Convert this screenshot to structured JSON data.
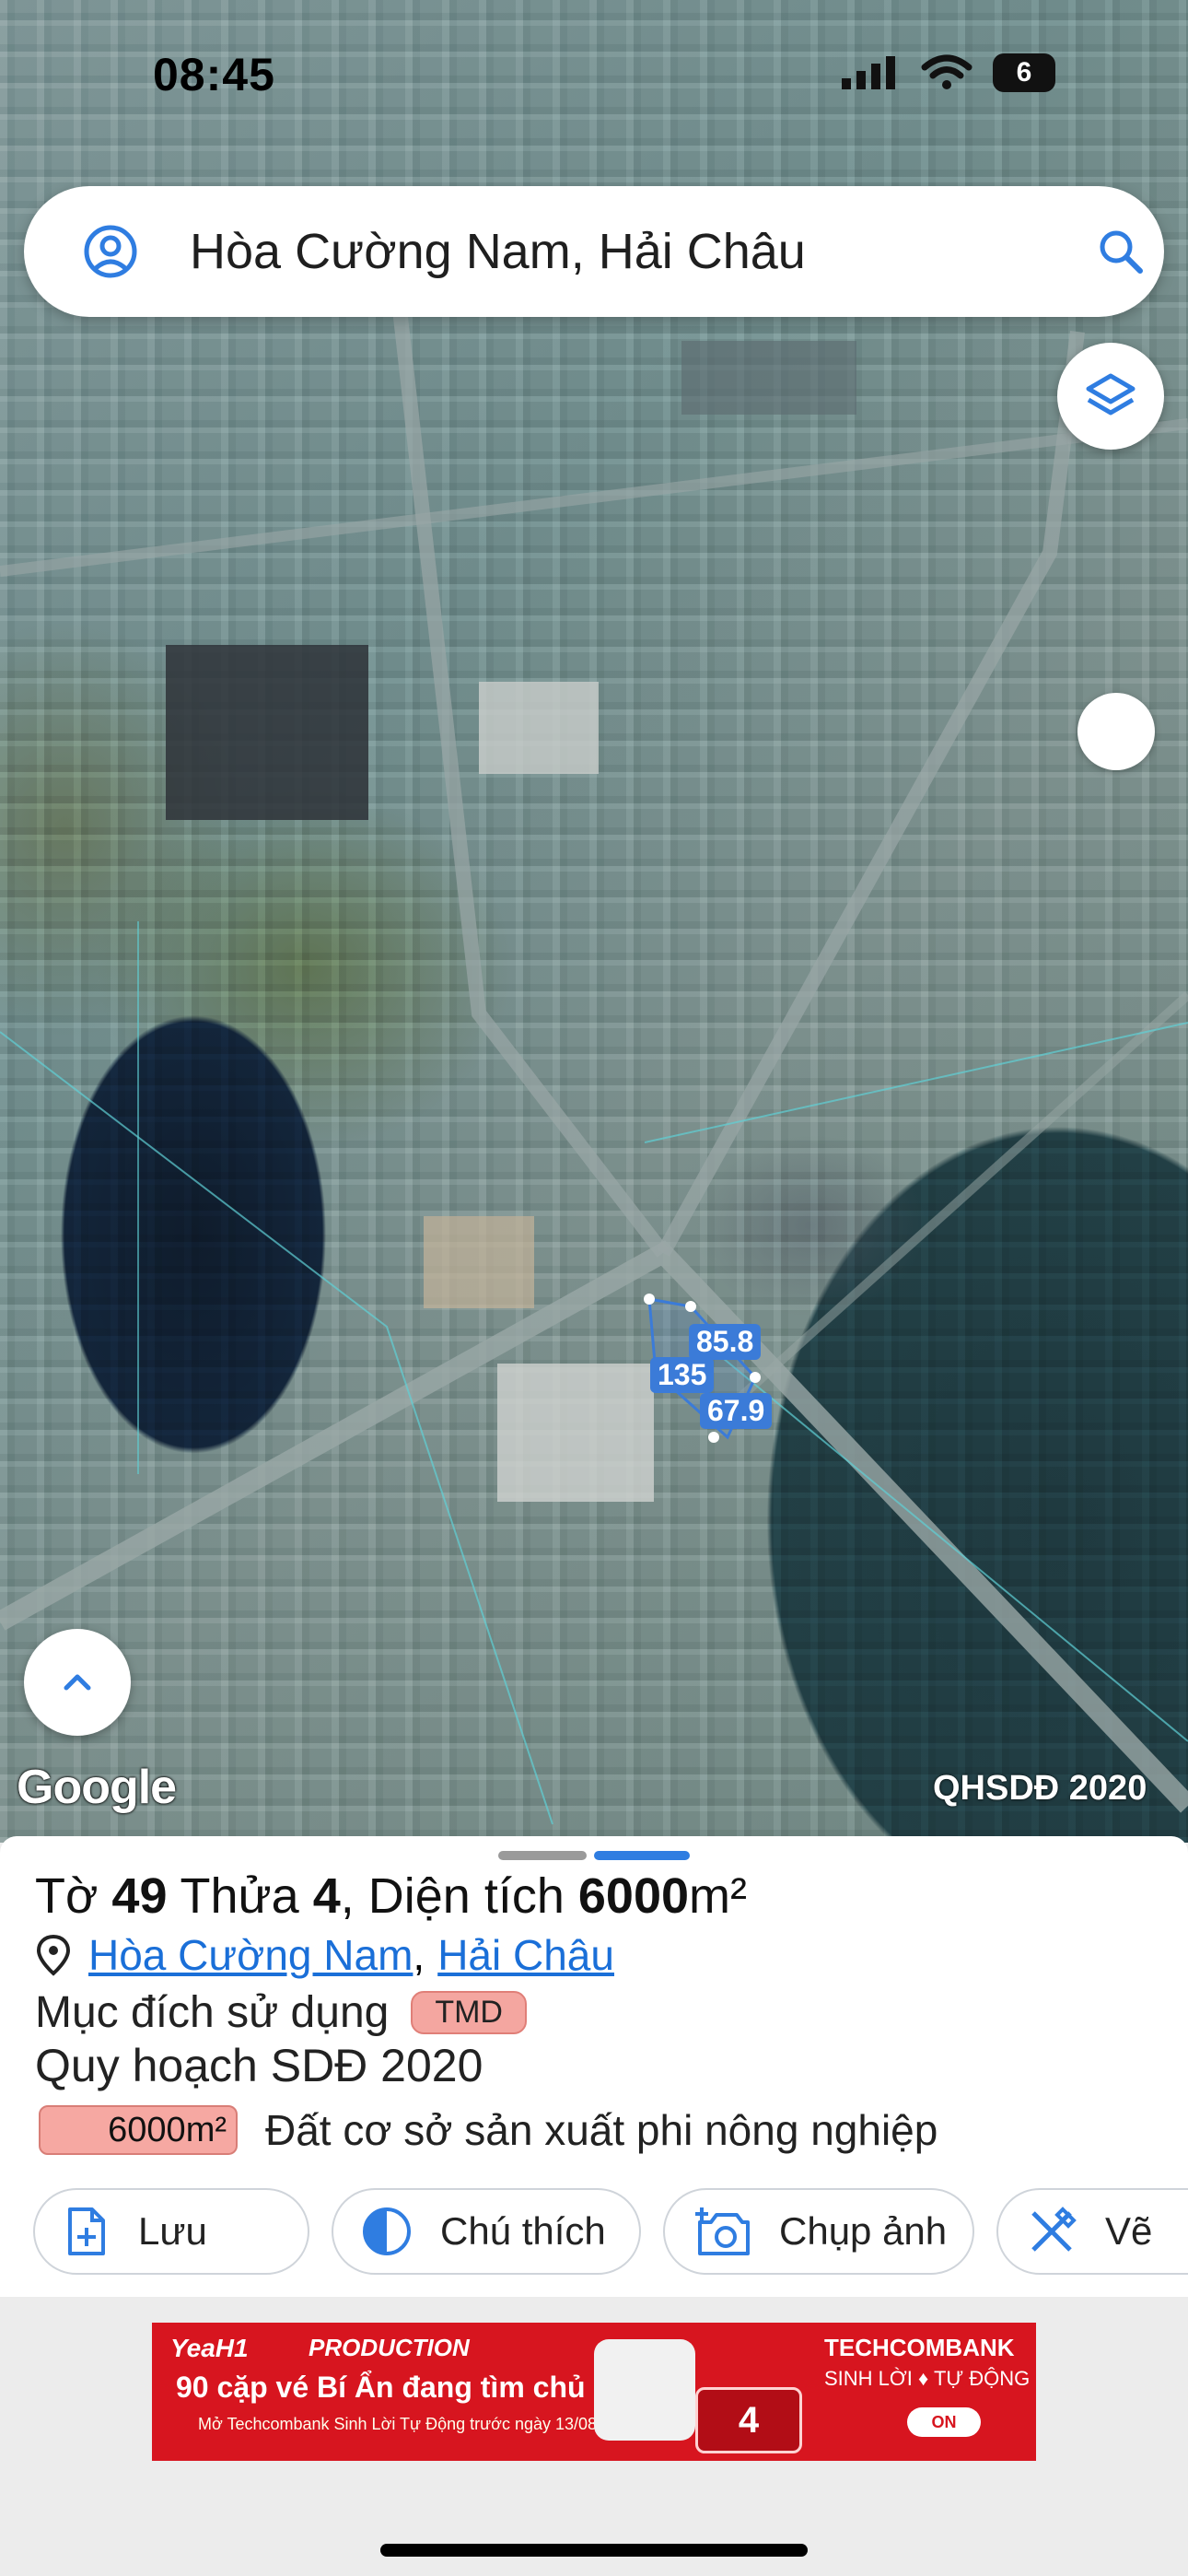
{
  "status_bar": {
    "time": "08:45",
    "battery": "6"
  },
  "search": {
    "text": "Hòa Cường Nam, Hải Châu"
  },
  "map": {
    "brand": "Google",
    "layer": "QHSDĐ 2020",
    "measurements": [
      "85.8",
      "135",
      "67.9"
    ]
  },
  "parcel": {
    "title_prefix": "Tờ ",
    "sheet": "49",
    "title_mid": " Thửa ",
    "lot": "4",
    "title_area_label": ", Diện tích ",
    "area": "6000",
    "area_unit": "m²",
    "ward": "Hòa Cường Nam",
    "separator": ",",
    "district": "Hải Châu",
    "purpose_label": "Mục đích sử dụng",
    "purpose_code": "TMD",
    "plan_title": "Quy hoạch SDĐ 2020",
    "plan_area": "6000m²",
    "plan_desc": "Đất cơ sở sản xuất phi nông nghiệp"
  },
  "actions": {
    "save": "Lưu",
    "legend": "Chú thích",
    "capture": "Chụp ảnh",
    "draw": "Vẽ"
  },
  "ad": {
    "brand1": "YeaH1",
    "brand2": "PRODUCTION",
    "headline": "90 cặp vé Bí Ẩn đang tìm chủ nhân",
    "subline": "Mở Techcombank Sinh Lời Tự Động trước ngày 13/08",
    "bank": "TECHCOMBANK",
    "bank_sub": "SINH LỜI ♦ TỰ ĐỘNG",
    "prize": "4",
    "toggle": "ON"
  },
  "colors": {
    "accent": "#2f7de1",
    "tag": "#f4a6a0",
    "ad_red": "#d7151f"
  }
}
